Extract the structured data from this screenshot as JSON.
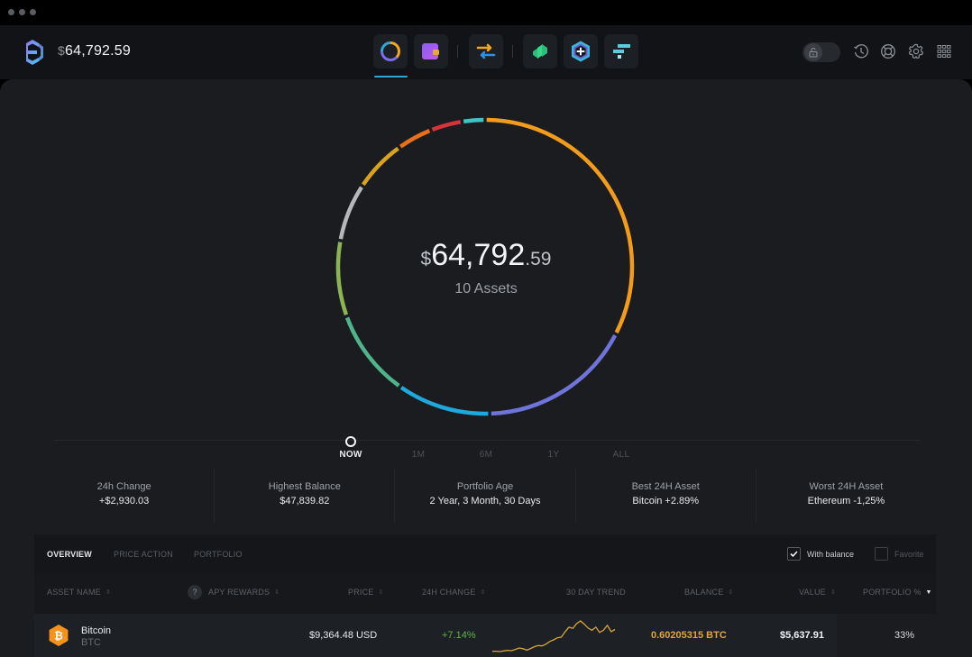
{
  "window": {
    "controls": [
      "close",
      "minimize",
      "maximize"
    ]
  },
  "header": {
    "logo_icon": "exodus-logo-icon",
    "balance_currency": "$",
    "balance_amount": "64,792.59",
    "nav": [
      {
        "name": "portfolio",
        "icon": "portfolio-ring-icon",
        "active": true
      },
      {
        "name": "wallet",
        "icon": "wallet-icon",
        "active": false
      },
      {
        "name": "exchange",
        "icon": "exchange-arrows-icon",
        "active": false
      },
      {
        "name": "compound",
        "icon": "compound-app-icon",
        "active": false
      },
      {
        "name": "add-app",
        "icon": "add-app-hex-icon",
        "active": false
      },
      {
        "name": "ftx",
        "icon": "ftx-app-icon",
        "active": false
      }
    ],
    "right_icons": [
      "lock-toggle",
      "history-icon",
      "support-icon",
      "settings-icon",
      "apps-grid-icon"
    ],
    "lock_state": "unlocked"
  },
  "portfolio": {
    "total_currency": "$",
    "total_whole": "64,792",
    "total_cents": ".59",
    "assets_label": "10 Assets",
    "allocation": [
      {
        "color": "#f39c1c",
        "share": 0.325
      },
      {
        "color": "#6e74d9",
        "share": 0.169
      },
      {
        "color": "#1ea8dc",
        "share": 0.103
      },
      {
        "color": "#4fb38c",
        "share": 0.097
      },
      {
        "color": "#8cb551",
        "share": 0.083
      },
      {
        "color": "#b5b7b9",
        "share": 0.064
      },
      {
        "color": "#d9a21f",
        "share": 0.058
      },
      {
        "color": "#e8701c",
        "share": 0.039
      },
      {
        "color": "#d4343a",
        "share": 0.035
      },
      {
        "color": "#3fc4c6",
        "share": 0.025
      }
    ]
  },
  "timeline": {
    "options": [
      "NOW",
      "1M",
      "6M",
      "1Y",
      "ALL"
    ],
    "selected": "NOW"
  },
  "stats": [
    {
      "label": "24h Change",
      "value": "+$2,930.03"
    },
    {
      "label": "Highest Balance",
      "value": "$47,839.82"
    },
    {
      "label": "Portfolio Age",
      "value": "2 Year, 3 Month, 30 Days"
    },
    {
      "label": "Best 24H Asset",
      "value": "Bitcoin +2.89%"
    },
    {
      "label": "Worst 24H Asset",
      "value": "Ethereum -1,25%"
    }
  ],
  "table": {
    "tabs": [
      "OVERVIEW",
      "PRICE ACTION",
      "PORTFOLIO"
    ],
    "active_tab": "OVERVIEW",
    "filters": [
      {
        "label": "With balance",
        "checked": true
      },
      {
        "label": "Favorite",
        "checked": false
      }
    ],
    "help_badge": "?",
    "columns": [
      "ASSET NAME",
      "APY REWARDS",
      "PRICE",
      "24H CHANGE",
      "30 DAY TREND",
      "BALANCE",
      "VALUE",
      "PORTFOLIO %"
    ],
    "sorted_column": "PORTFOLIO %",
    "rows": [
      {
        "name": "Bitcoin",
        "ticker": "BTC",
        "icon": "bitcoin-icon",
        "icon_color": "#f7931a",
        "price": "$9,364.48 USD",
        "change": "+7.14%",
        "change_color": "#5fb548",
        "trend": [
          2,
          2,
          1.8,
          2.2,
          2.5,
          2.3,
          3,
          3.8,
          3.4,
          2.6,
          3.5,
          4.6,
          5.2,
          5.0,
          6.0,
          7.5,
          8.4,
          9.6,
          9.9,
          13.0,
          15.5,
          14.8,
          17.5,
          19.0,
          17.2,
          15.0,
          13.8,
          15.5,
          12.6,
          13.8,
          16.5,
          13.0,
          14.2
        ],
        "trend_color": "#d9a53a",
        "balance": "0.60205315 BTC",
        "balance_color": "#e2a53d",
        "value": "$5,637.91",
        "portfolio_pct": "33%"
      }
    ]
  }
}
